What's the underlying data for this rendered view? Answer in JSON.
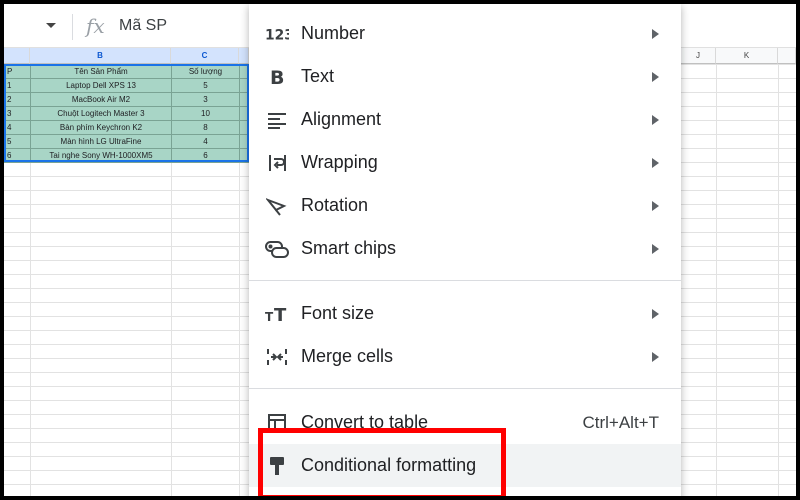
{
  "formula_bar": {
    "fx_label": "fx",
    "cell_value": "Mã SP"
  },
  "columns": {
    "b": "B",
    "c": "C",
    "j": "J",
    "k": "K"
  },
  "table": {
    "header": {
      "row": "P",
      "name": "Tên Sản Phẩm",
      "qty": "Số lượng"
    },
    "rows": [
      {
        "row": "1",
        "name": "Laptop Dell XPS 13",
        "qty": "5"
      },
      {
        "row": "2",
        "name": "MacBook Air M2",
        "qty": "3"
      },
      {
        "row": "3",
        "name": "Chuột Logitech Master 3",
        "qty": "10"
      },
      {
        "row": "4",
        "name": "Bàn phím Keychron K2",
        "qty": "8"
      },
      {
        "row": "5",
        "name": "Màn hình LG UltraFine",
        "qty": "4"
      },
      {
        "row": "6",
        "name": "Tai nghe Sony WH-1000XM5",
        "qty": "6"
      }
    ]
  },
  "menu": {
    "items": [
      {
        "label": "Number",
        "icon": "number-format-icon"
      },
      {
        "label": "Text",
        "icon": "bold-icon"
      },
      {
        "label": "Alignment",
        "icon": "align-left-icon"
      },
      {
        "label": "Wrapping",
        "icon": "wrap-text-icon"
      },
      {
        "label": "Rotation",
        "icon": "text-rotation-icon"
      },
      {
        "label": "Smart chips",
        "icon": "smart-chip-icon"
      },
      {
        "label": "Font size",
        "icon": "font-size-icon"
      },
      {
        "label": "Merge cells",
        "icon": "merge-cells-icon"
      },
      {
        "label": "Convert to table",
        "icon": "table-icon",
        "shortcut": "Ctrl+Alt+T"
      },
      {
        "label": "Conditional formatting",
        "icon": "paint-format-icon"
      }
    ]
  },
  "colors": {
    "highlight": "#ff0000",
    "table_fill": "#a8d5c6",
    "selection": "#1a73e8"
  }
}
